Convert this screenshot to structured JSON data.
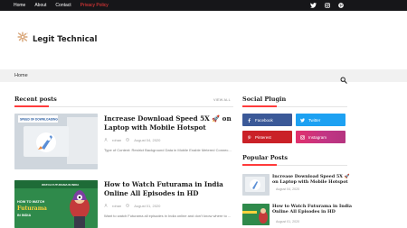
{
  "topbar": {
    "nav": [
      "Home",
      "About",
      "Contact",
      "Privacy Policy"
    ],
    "social_icons": [
      "twitter-icon",
      "instagram-icon",
      "pinterest-icon"
    ]
  },
  "site": {
    "title": "Legit Technical"
  },
  "menu": {
    "home": "Home"
  },
  "recent": {
    "heading": "Recent posts",
    "view_all": "VIEW ALL",
    "posts": [
      {
        "title": "Increase Download Speed 5X 🚀 on Laptop with Mobile Hotspot",
        "author": "rohan",
        "date": "August 04, 2020",
        "excerpt": "Type of Content: Restrict Background Data in Mobile Enable Metered Connec...",
        "thumb_caption": "SPEED OF DOWNLOADING"
      },
      {
        "title": "How to Watch Futurama in India Online All Episodes in HD",
        "author": "rohan",
        "date": "August 01, 2020",
        "excerpt": "Want to watch Futurama all episodes in India online and don't know where to ...",
        "thumb_caption": "WATCH FUTURAMA IN INDIA",
        "thumb_text": "HOW TO WATCH Futurama IN INDIA"
      }
    ]
  },
  "social_plugin": {
    "heading": "Social Plugin",
    "buttons": [
      {
        "label": "Facebook",
        "icon": "facebook-icon",
        "color": "#3b5998"
      },
      {
        "label": "Twitter",
        "icon": "twitter-icon",
        "color": "#1da1f2"
      },
      {
        "label": "Pinterest",
        "icon": "pinterest-icon",
        "color": "#ca2127"
      },
      {
        "label": "Instagram",
        "icon": "instagram-icon",
        "color": "#d6249f"
      }
    ]
  },
  "popular": {
    "heading": "Popular Posts",
    "posts": [
      {
        "title": "Increase Download Speed 5X 🚀 on Laptop with Mobile Hotspot",
        "date": "August 04, 2020"
      },
      {
        "title": "How to Watch Futurama in India Online All Episodes in HD",
        "date": "August 01, 2020"
      }
    ]
  },
  "colors": {
    "accent": "#ff3b3b",
    "topbar": "#161619",
    "menubar": "#f1f1f1"
  }
}
